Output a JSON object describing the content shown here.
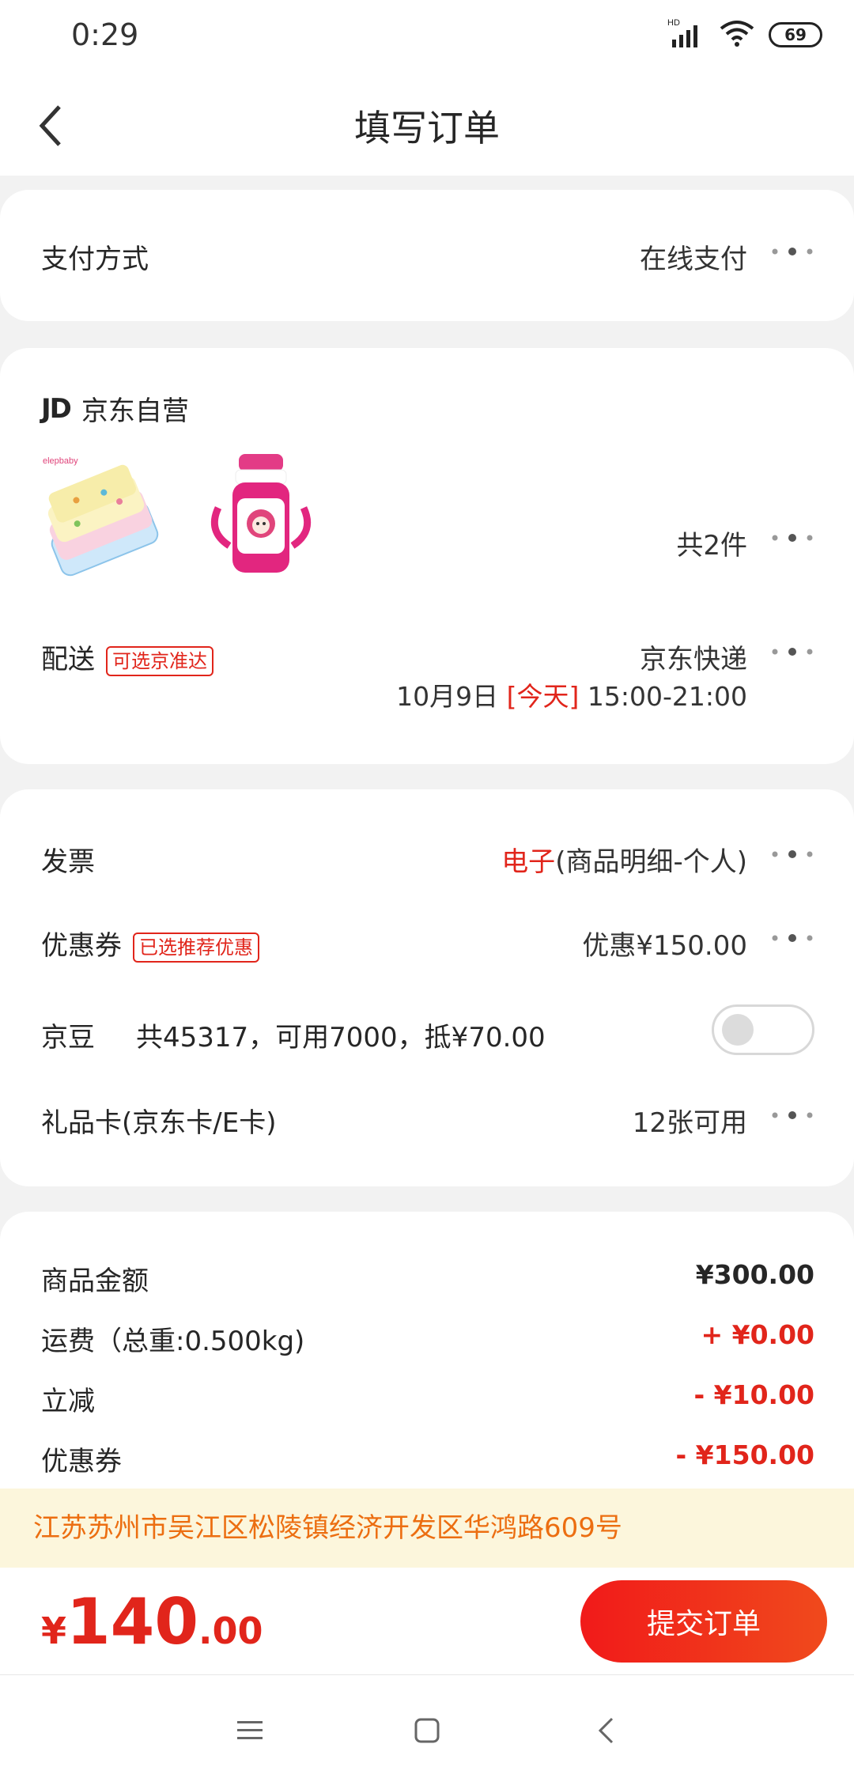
{
  "status_bar": {
    "time": "0:29",
    "battery": "69",
    "network": "HD"
  },
  "header": {
    "title": "填写订单"
  },
  "payment": {
    "label": "支付方式",
    "value": "在线支付"
  },
  "shop": {
    "logo": "JD",
    "name": "京东自营",
    "item_count": "共2件",
    "delivery_label": "配送",
    "delivery_tag": "可选京准达",
    "delivery_carrier": "京东快递",
    "delivery_date": "10月9日",
    "delivery_today": "[今天]",
    "delivery_time": "15:00-21:00"
  },
  "options": {
    "invoice_label": "发票",
    "invoice_type": "电子",
    "invoice_detail": "(商品明细-个人)",
    "coupon_label": "优惠券",
    "coupon_tag": "已选推荐优惠",
    "coupon_value": "优惠¥150.00",
    "beans_label": "京豆",
    "beans_detail": "共45317，可用7000，抵¥70.00",
    "beans_enabled": false,
    "giftcard_label": "礼品卡(京东卡/E卡)",
    "giftcard_value": "12张可用"
  },
  "summary": {
    "goods_label": "商品金额",
    "goods_value": "¥300.00",
    "shipping_label": "运费（总重:0.500kg)",
    "shipping_value": "+ ¥0.00",
    "discount_label": "立减",
    "discount_value": "- ¥10.00",
    "coupon_label": "优惠券",
    "coupon_value": "- ¥150.00"
  },
  "address": "江苏苏州市吴江区松陵镇经济开发区华鸿路609号",
  "total": {
    "currency": "¥",
    "integer": "140",
    "decimal": ".00"
  },
  "submit_label": "提交订单",
  "colors": {
    "accent": "#e1251b",
    "address_bg": "#fcf6dc",
    "address_text": "#ec6e11"
  }
}
